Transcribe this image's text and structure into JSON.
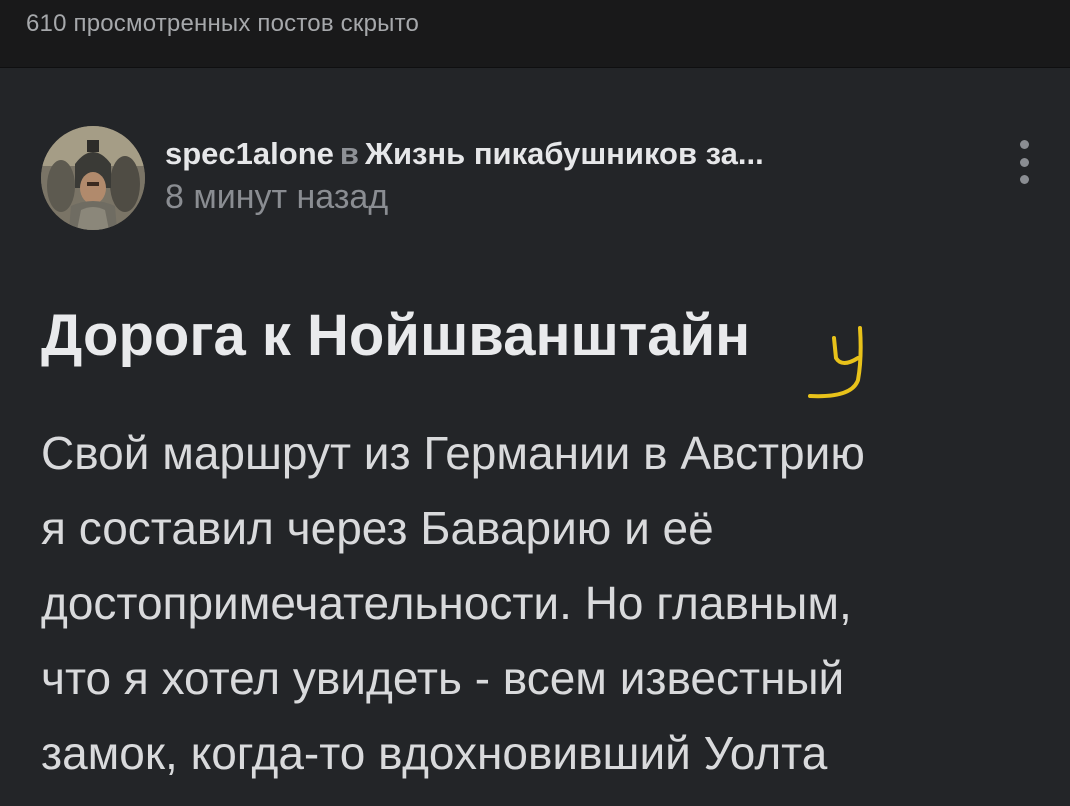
{
  "topbar": {
    "hidden_posts": "610 просмотренных постов скрыто"
  },
  "post": {
    "author": "spec1alone",
    "in_word": "в",
    "community": "Жизнь пикабушников за...",
    "time": "8 минут назад",
    "title": "Дорога к Нойшванштайн",
    "title_scribble": "у",
    "body_lines": [
      "Свой маршрут из Германии в Австрию",
      "я составил через Баварию и её",
      "достопримечательности. Но главным,",
      "что я хотел увидеть - всем известный",
      "замок, когда-то вдохновивший Уолта"
    ]
  },
  "icons": {
    "more": "more-vertical-icon",
    "avatar": "user-avatar-warrior-helmet"
  },
  "colors": {
    "background": "#232528",
    "topbar": "#19191a",
    "scribble": "#e8c21a"
  }
}
